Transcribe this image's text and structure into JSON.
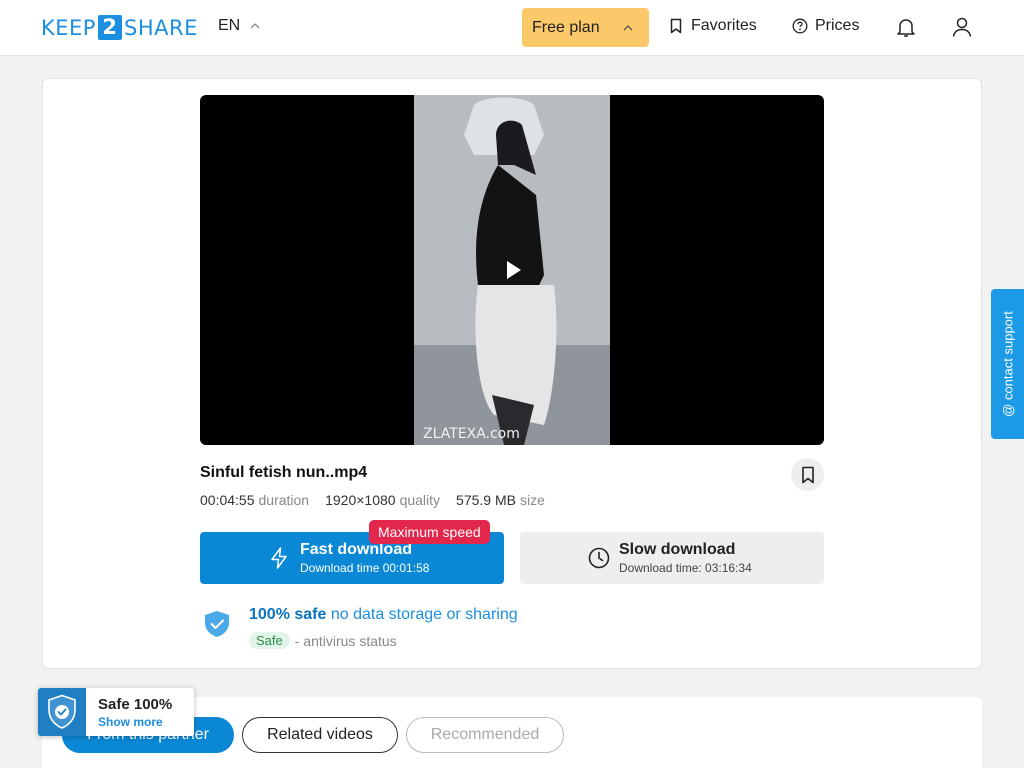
{
  "header": {
    "logo": {
      "prefix": "KEEP",
      "number": "2",
      "suffix": "SHARE"
    },
    "language": "EN",
    "plan": "Free plan",
    "favorites": "Favorites",
    "prices": "Prices"
  },
  "player": {
    "watermark": "ZLATEXA.com"
  },
  "file": {
    "title": "Sinful fetish nun..mp4",
    "duration": {
      "value": "00:04:55",
      "label": "duration"
    },
    "quality": {
      "value": "1920×1080",
      "label": "quality"
    },
    "size": {
      "value": "575.9 MB",
      "label": "size"
    }
  },
  "downloads": {
    "badge": "Maximum speed",
    "fast": {
      "label": "Fast download",
      "time": "Download time 00:01:58"
    },
    "slow": {
      "label": "Slow download",
      "time": "Download time: 03:16:34"
    }
  },
  "safety": {
    "strong": "100% safe",
    "rest": "no data storage or sharing",
    "tag": "Safe",
    "status": "- antivirus status"
  },
  "support": {
    "label": "@ contact support"
  },
  "tabs": [
    {
      "label": "From this partner"
    },
    {
      "label": "Related videos"
    },
    {
      "label": "Recommended"
    }
  ],
  "safe_widget": {
    "title": "Safe 100%",
    "link": "Show more"
  },
  "colors": {
    "accent": "#0a88d6",
    "plan_button": "#fbc96a",
    "badge": "#e3264b",
    "support": "#1c9ae6"
  }
}
